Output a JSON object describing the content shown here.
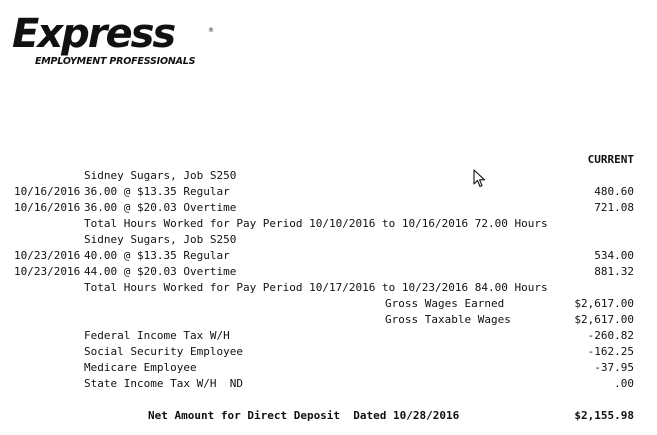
{
  "logo": {
    "wordmark": "Express",
    "registered": "®",
    "tagline": "EMPLOYMENT PROFESSIONALS"
  },
  "header": {
    "current_label": "CURRENT"
  },
  "period1": {
    "job": "Sidney Sugars, Job S250",
    "lines": [
      {
        "date": "10/16/2016",
        "desc": "36.00 @ $13.35 Regular",
        "amount": "480.60"
      },
      {
        "date": "10/16/2016",
        "desc": "36.00 @ $20.03 Overtime",
        "amount": "721.08"
      }
    ],
    "total": "Total Hours Worked for Pay Period 10/10/2016 to 10/16/2016 72.00 Hours"
  },
  "period2": {
    "job": "Sidney Sugars, Job S250",
    "lines": [
      {
        "date": "10/23/2016",
        "desc": "40.00 @ $13.35 Regular",
        "amount": "534.00"
      },
      {
        "date": "10/23/2016",
        "desc": "44.00 @ $20.03 Overtime",
        "amount": "881.32"
      }
    ],
    "total": "Total Hours Worked for Pay Period 10/17/2016 to 10/23/2016 84.00 Hours"
  },
  "wages": {
    "gross_earned_label": "Gross Wages Earned",
    "gross_earned": "$2,617.00",
    "gross_taxable_label": "Gross Taxable Wages",
    "gross_taxable": "$2,617.00"
  },
  "deductions": [
    {
      "label": "Federal Income Tax W/H",
      "amount": "-260.82"
    },
    {
      "label": "Social Security Employee",
      "amount": "-162.25"
    },
    {
      "label": "Medicare Employee",
      "amount": "-37.95"
    },
    {
      "label": "State Income Tax W/H  ND",
      "amount": ".00"
    }
  ],
  "net": {
    "label": "Net Amount for Direct Deposit  Dated 10/28/2016",
    "amount": "$2,155.98"
  }
}
